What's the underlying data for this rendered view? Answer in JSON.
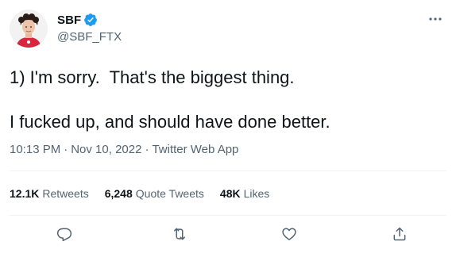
{
  "author": {
    "display_name": "SBF",
    "handle": "@SBF_FTX",
    "verified": true,
    "avatar_icon": "profile-avatar",
    "verified_icon": "verified-badge-icon"
  },
  "tweet": {
    "lines": [
      "1) I'm sorry.  That's the biggest thing.",
      "I fucked up, and should have done better."
    ]
  },
  "meta": {
    "time": "10:13 PM",
    "separator": "·",
    "date": "Nov 10, 2022",
    "source": "Twitter Web App"
  },
  "stats": {
    "retweets": {
      "count": "12.1K",
      "label": "Retweets"
    },
    "quotes": {
      "count": "6,248",
      "label": "Quote Tweets"
    },
    "likes": {
      "count": "48K",
      "label": "Likes"
    }
  },
  "actions": {
    "reply_icon": "reply-icon",
    "retweet_icon": "retweet-icon",
    "like_icon": "heart-icon",
    "share_icon": "share-icon"
  },
  "colors": {
    "text_primary": "#0f1419",
    "text_secondary": "#536471",
    "verified_blue": "#1d9bf0",
    "divider": "#eff3f4",
    "icon_gray": "#536471"
  }
}
